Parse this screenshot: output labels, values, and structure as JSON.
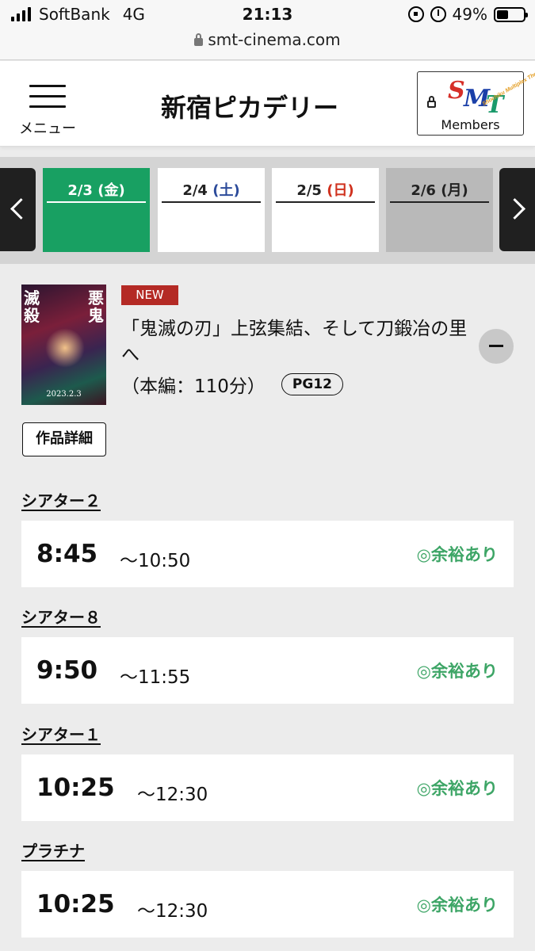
{
  "status_bar": {
    "carrier": "SoftBank",
    "network": "4G",
    "time": "21:13",
    "battery": "49%",
    "battery_level": 0.49
  },
  "browser": {
    "url": "smt-cinema.com"
  },
  "header": {
    "menu_label": "メニュー",
    "theater_name": "新宿ピカデリー",
    "members_label": "Members",
    "logo_letters": [
      "S",
      "M",
      "T"
    ],
    "logo_sub": "Shochiku Multiplex Theatres"
  },
  "dates": [
    {
      "date": "2/3",
      "dow": "(金)",
      "state": "active"
    },
    {
      "date": "2/4",
      "dow": "(土)",
      "state": "normal"
    },
    {
      "date": "2/5",
      "dow": "(日)",
      "state": "normal"
    },
    {
      "date": "2/6",
      "dow": "(月)",
      "state": "disabled"
    }
  ],
  "movie": {
    "badge": "NEW",
    "title": "「鬼滅の刃」上弦集結、そして刀鍛冶の里へ",
    "runtime": "（本編：110分）",
    "rating": "PG12",
    "detail_button": "作品詳細",
    "poster_text_left": "滅殺",
    "poster_text_right": "悪鬼",
    "poster_date": "2023.2.3"
  },
  "showtimes": [
    {
      "screen": "シアター２",
      "start": "8:45",
      "end": "〜10:50",
      "availability": "◎余裕あり"
    },
    {
      "screen": "シアター８",
      "start": "9:50",
      "end": "〜11:55",
      "availability": "◎余裕あり"
    },
    {
      "screen": "シアター１",
      "start": "10:25",
      "end": "〜12:30",
      "availability": "◎余裕あり"
    },
    {
      "screen": "プラチナ",
      "start": "10:25",
      "end": "〜12:30",
      "availability": "◎余裕あり"
    }
  ],
  "colors": {
    "active_date": "#18a062",
    "availability": "#3da566",
    "new_badge": "#b42a25",
    "saturday": "#2c4b9a",
    "sunday": "#d0321f"
  }
}
